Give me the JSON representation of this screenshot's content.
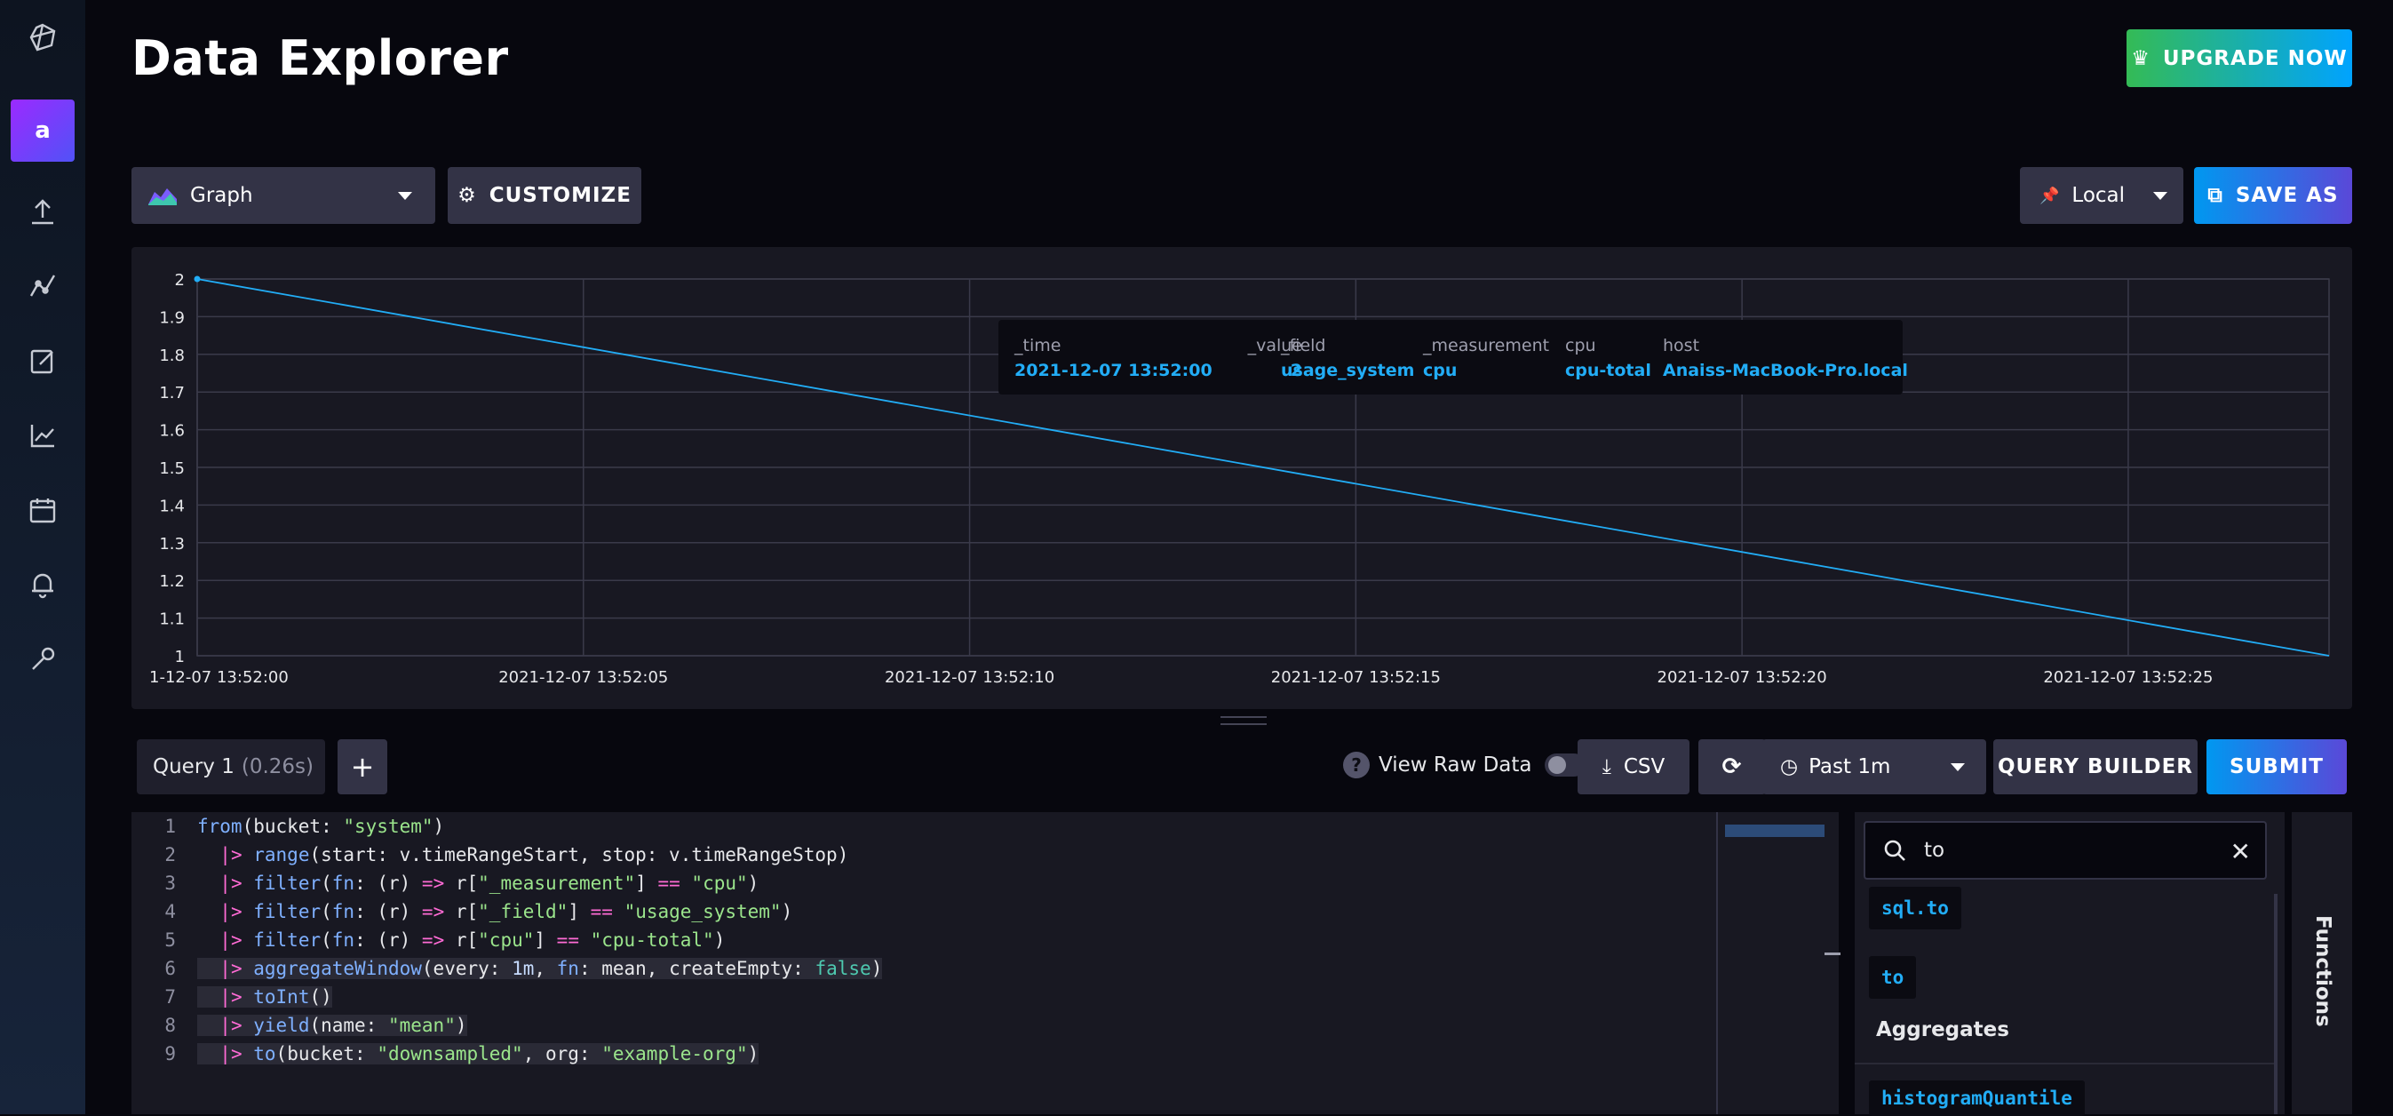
{
  "sidebar": {
    "avatar_letter": "a",
    "icons": [
      "logo-icon",
      "upload-icon",
      "data-explorer-icon",
      "notebook-icon",
      "dashboard-icon",
      "tasks-icon",
      "alerts-icon",
      "settings-icon"
    ]
  },
  "header": {
    "title": "Data Explorer",
    "upgrade_label": "UPGRADE NOW"
  },
  "toolbar": {
    "graph_label": "Graph",
    "customize_label": "CUSTOMIZE",
    "timezone_label": "Local",
    "save_as_label": "SAVE AS"
  },
  "chart_data": {
    "type": "line",
    "x_ticks": [
      "1-12-07 13:52:00",
      "2021-12-07 13:52:05",
      "2021-12-07 13:52:10",
      "2021-12-07 13:52:15",
      "2021-12-07 13:52:20",
      "2021-12-07 13:52:25"
    ],
    "y_ticks": [
      "2",
      "1.9",
      "1.8",
      "1.7",
      "1.6",
      "1.5",
      "1.4",
      "1.3",
      "1.2",
      "1.1",
      "1"
    ],
    "ylim": [
      1,
      2
    ],
    "grid": true,
    "series": [
      {
        "color": "#22adf6",
        "points": [
          {
            "x": "2021-12-07 13:52:00",
            "y": 2
          },
          {
            "x": "2021-12-07 13:52:27.6",
            "y": 1
          }
        ]
      }
    ],
    "tooltip": {
      "columns": [
        {
          "header": "_time",
          "value": "2021-12-07 13:52:00"
        },
        {
          "header": "_value",
          "value": "2"
        },
        {
          "header": "_field",
          "value": "usage_system"
        },
        {
          "header": "_measurement",
          "value": "cpu"
        },
        {
          "header": "cpu",
          "value": "cpu-total"
        },
        {
          "header": "host",
          "value": "Anaiss-MacBook-Pro.local"
        }
      ]
    }
  },
  "query": {
    "tab_label": "Query 1",
    "tab_time": "(0.26s)",
    "add_label": "+",
    "view_raw_label": "View Raw Data",
    "view_raw_help": "?",
    "csv_label": "CSV",
    "time_range_label": "Past 1m",
    "query_builder_label": "QUERY BUILDER",
    "submit_label": "SUBMIT"
  },
  "editor": {
    "lines": [
      {
        "num": "1",
        "text": "from(bucket: \"system\")"
      },
      {
        "num": "2",
        "text": "  |> range(start: v.timeRangeStart, stop: v.timeRangeStop)"
      },
      {
        "num": "3",
        "text": "  |> filter(fn: (r) => r[\"_measurement\"] == \"cpu\")"
      },
      {
        "num": "4",
        "text": "  |> filter(fn: (r) => r[\"_field\"] == \"usage_system\")"
      },
      {
        "num": "5",
        "text": "  |> filter(fn: (r) => r[\"cpu\"] == \"cpu-total\")"
      },
      {
        "num": "6",
        "text": "  |> aggregateWindow(every: 1m, fn: mean, createEmpty: false)"
      },
      {
        "num": "7",
        "text": "  |> toInt()"
      },
      {
        "num": "8",
        "text": "  |> yield(name: \"mean\")"
      },
      {
        "num": "9",
        "text": "  |> to(bucket: \"downsampled\", org: \"example-org\")"
      }
    ]
  },
  "functions": {
    "search_value": "to",
    "items": [
      "sql.to",
      "to"
    ],
    "category": "Aggregates",
    "next_item": "histogramQuantile",
    "tab_label": "Functions"
  }
}
